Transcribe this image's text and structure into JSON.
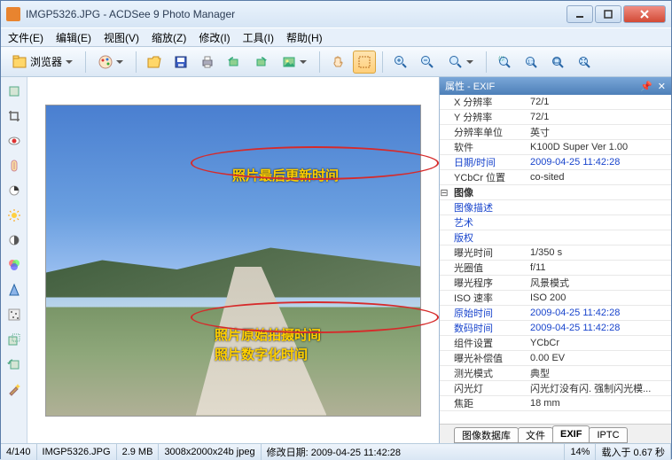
{
  "title": "IMGP5326.JPG - ACDSee 9 Photo Manager",
  "menu": [
    "文件(E)",
    "编辑(E)",
    "视图(V)",
    "缩放(Z)",
    "修改(I)",
    "工具(I)",
    "帮助(H)"
  ],
  "toolbar": {
    "browser": "浏览器"
  },
  "annotations": {
    "last_modified": "照片最后更新时间",
    "original_time": "照片原始拍摄时间",
    "digital_time": "照片数字化时间"
  },
  "panel": {
    "title": "属性 - EXIF",
    "rows": [
      {
        "k": "X 分辨率",
        "v": "72/1"
      },
      {
        "k": "Y 分辨率",
        "v": "72/1"
      },
      {
        "k": "分辨率单位",
        "v": "英寸"
      },
      {
        "k": "软件",
        "v": "K100D Super Ver 1.00"
      },
      {
        "k": "日期/时间",
        "v": "2009-04-25 11:42:28",
        "link": true
      },
      {
        "k": "YCbCr 位置",
        "v": "co-sited"
      },
      {
        "k": "图像",
        "v": "",
        "group": true
      },
      {
        "k": "图像描述",
        "v": "",
        "link": true
      },
      {
        "k": "艺术",
        "v": "",
        "link": true
      },
      {
        "k": "版权",
        "v": "",
        "link": true
      },
      {
        "k": "曝光时间",
        "v": "1/350 s"
      },
      {
        "k": "光圈值",
        "v": "f/11"
      },
      {
        "k": "曝光程序",
        "v": "风景模式"
      },
      {
        "k": "ISO 速率",
        "v": "ISO 200"
      },
      {
        "k": "原始时间",
        "v": "2009-04-25 11:42:28",
        "link": true
      },
      {
        "k": "数码时间",
        "v": "2009-04-25 11:42:28",
        "link": true
      },
      {
        "k": "组件设置",
        "v": "YCbCr"
      },
      {
        "k": "曝光补偿值",
        "v": "0.00 EV"
      },
      {
        "k": "测光模式",
        "v": "典型"
      },
      {
        "k": "闪光灯",
        "v": "闪光灯没有闪. 强制闪光模..."
      },
      {
        "k": "焦距",
        "v": "18 mm"
      }
    ],
    "tabs": [
      "图像数据库",
      "文件",
      "EXIF",
      "IPTC"
    ],
    "active_tab": "EXIF"
  },
  "status": {
    "pos": "4/140",
    "file": "IMGP5326.JPG",
    "size": "2.9 MB",
    "dims": "3008x2000x24b jpeg",
    "modified": "修改日期: 2009-04-25 11:42:28",
    "zoom": "14%",
    "loaded": "载入于 0.67 秒"
  }
}
